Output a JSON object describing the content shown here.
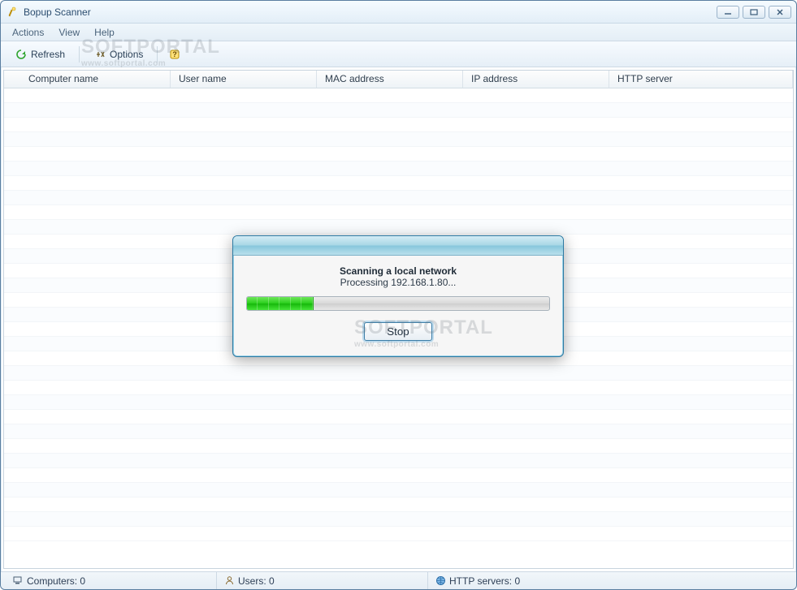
{
  "window": {
    "title": "Bopup Scanner"
  },
  "menubar": {
    "items": [
      "Actions",
      "View",
      "Help"
    ]
  },
  "toolbar": {
    "refresh_label": "Refresh",
    "options_label": "Options"
  },
  "columns": {
    "computer_name": "Computer name",
    "user_name": "User name",
    "mac_address": "MAC address",
    "ip_address": "IP address",
    "http_server": "HTTP server"
  },
  "statusbar": {
    "computers": "Computers: 0",
    "users": "Users: 0",
    "http_servers": "HTTP servers: 0"
  },
  "dialog": {
    "heading": "Scanning a local network",
    "subtext": "Processing 192.168.1.80...",
    "stop_label": "Stop",
    "progress_percent": 22
  },
  "watermark": {
    "brand": "SOFTPORTAL",
    "url": "www.softportal.com"
  }
}
